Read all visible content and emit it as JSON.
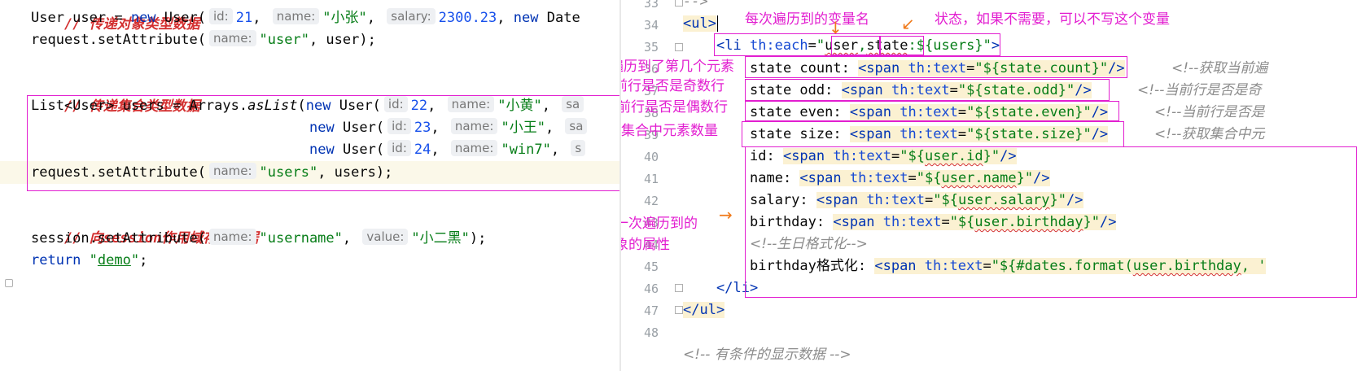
{
  "left_editor": {
    "lines": [
      {
        "id": "l0",
        "type": "header",
        "text": "// 传递对象类型数据"
      },
      {
        "id": "l1",
        "type": "code"
      },
      {
        "id": "l2",
        "type": "code"
      },
      {
        "id": "l3",
        "type": "blank"
      },
      {
        "id": "l4",
        "type": "header",
        "text": "// 传递集合类型数据"
      },
      {
        "id": "l5",
        "type": "code"
      },
      {
        "id": "l6",
        "type": "code"
      },
      {
        "id": "l7",
        "type": "code"
      },
      {
        "id": "l8",
        "type": "code"
      },
      {
        "id": "l9",
        "type": "blank"
      },
      {
        "id": "l10",
        "type": "header",
        "text": "// 向session作用域存储数据"
      },
      {
        "id": "l11",
        "type": "code"
      },
      {
        "id": "l12",
        "type": "code"
      }
    ],
    "t": {
      "user_decl": "User user = ",
      "new": "new",
      "user_ctor": " User(",
      "hint_id": "id:",
      "v21": "21",
      "comma_sp": ", ",
      "hint_name": "name:",
      "s_zhang": "\"小张\"",
      "hint_salary": "salary:",
      "v_salary": "2300.23",
      "comma": ",",
      "date_ctor": " Date",
      "req_set": "request.setAttribute(",
      "s_user": "\"user\"",
      "user_end": ", user);",
      "list_decl": "List<User> users = Arrays.",
      "as_list": "asList",
      "paren": "(",
      "v22": "22",
      "s_huang": "\"小黄\"",
      "cut_sa": "sa",
      "v23": "23",
      "s_wang": "\"小王\"",
      "v24": "24",
      "s_win7": "\"win7\"",
      "cut_s": "s",
      "s_users": "\"users\"",
      "users_end": ", users);",
      "sess_set": "session.setAttribute(",
      "s_username": "\"username\"",
      "hint_value": "value:",
      "s_xiaoerhei": "\"小二黑\"",
      "close_semi": ");",
      "return_kw": "return",
      "q": "\"",
      "demo": "demo",
      "semi": ";"
    }
  },
  "right_editor": {
    "line_numbers": [
      "33",
      "34",
      "35",
      "36",
      "37",
      "38",
      "39",
      "40",
      "41",
      "42",
      "43",
      "44",
      "45",
      "46",
      "47",
      "48"
    ],
    "t": {
      "top_cut": "-->",
      "ul_open": "<ul>",
      "li_open": "<li ",
      "th_each": "th:each",
      "eq": "=",
      "q": "\"",
      "v_user": "user",
      "comma": ",",
      "v_state": "state",
      "colon_expr": ":${users}",
      "close_gt": ">",
      "sc_label": "state count: ",
      "so_label": "state odd: ",
      "se_label": "state even: ",
      "ss_label": "state size: ",
      "span_open": "<span ",
      "th_text": "th:text",
      "e_count": "\"${state.count}\"",
      "e_odd": "\"${state.odd}\"",
      "e_even": "\"${state.even}\"",
      "e_size": "\"${state.size}\"",
      "self_close": "/>",
      "c_count": "<!--获取当前遍",
      "c_odd": "<!--当前行是否是奇",
      "c_even": "<!--当前行是否是",
      "c_size": "<!--获取集合中元",
      "id_label": "id: ",
      "e_id_pre": "\"${",
      "e_id": "user.id",
      "e_post": "}\"",
      "name_label": "name: ",
      "e_name": "user.name",
      "salary_label": "salary: ",
      "e_salary": "user.salary",
      "bday_label": "birthday: ",
      "e_bday": "user.birthday",
      "bday_cmt": "<!--生日格式化-->",
      "bfmt_label": "birthday格式化: ",
      "e_fmt_pre": "\"${",
      "e_fmt_fn": "#dates.format(",
      "e_fmt_arg": "user.birthday",
      "e_fmt_tail": ", '",
      "li_close": "</li>",
      "ul_close": "</ul>",
      "bottom_cut": "<!-- 有条件的显示数据 -->"
    }
  },
  "annotations": {
    "var_name": "每次遍历到的变量名",
    "state_note": "状态，如果不需要，可以不写这个变量",
    "count_note": "当前遍历到了第几个元素",
    "odd_note": "当前行是否是奇数行",
    "even_note": "当前行是否是偶数行",
    "size_note": "集合中元素数量",
    "attr_note_1": "每一次遍历到的",
    "attr_note_2": "对象的属性"
  },
  "colors": {
    "annotation": "#e21ed0",
    "arrow": "#f07a1a",
    "keyword": "#0033b3",
    "string": "#067d17",
    "number": "#1750eb",
    "comment_header": "#d32f2f",
    "comment": "#8c8c8c",
    "thymeleaf_highlight": "#fbf1d2"
  }
}
